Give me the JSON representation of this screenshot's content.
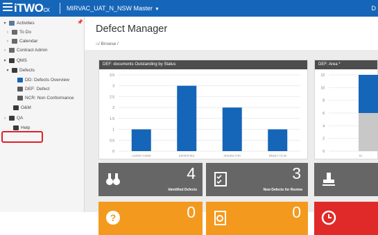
{
  "topbar": {
    "logo": "iTWO",
    "logo_suffix": "cx",
    "project_name": "MIRVAC_UAT_N_NSW Master",
    "right_text": "D",
    "color": "#1565b8"
  },
  "sidebar": {
    "items": [
      {
        "label": "Activities",
        "arrow": "▾",
        "icon": "activities-icon"
      },
      {
        "label": "To Do",
        "arrow": "›",
        "icon": "todo-icon"
      },
      {
        "label": "Calendar",
        "arrow": "›",
        "icon": "calendar-icon"
      },
      {
        "label": "Contract Admin",
        "arrow": "›",
        "icon": "contract-admin-icon"
      },
      {
        "label": "QMS",
        "arrow": "▾",
        "icon": "folder-icon"
      },
      {
        "label": "Defects",
        "arrow": "▾",
        "icon": "defects-icon"
      },
      {
        "label": "DD: Defects Overview",
        "arrow": "",
        "icon": "overview-icon"
      },
      {
        "label": "DEF: Defect",
        "arrow": "",
        "icon": "defect-icon"
      },
      {
        "label": "NCR: Non Conformance",
        "arrow": "",
        "icon": "ncr-icon"
      },
      {
        "label": "O&M",
        "arrow": "",
        "icon": "folder-icon"
      },
      {
        "label": "QA",
        "arrow": "›",
        "icon": "qa-icon"
      },
      {
        "label": "Help",
        "arrow": "",
        "icon": "help-icon"
      }
    ],
    "highlight_color": "#e0202a"
  },
  "main": {
    "title": "Defect Manager",
    "breadcrumb": "/ Browse /"
  },
  "panels": {
    "status_chart_title": "DEF: documents Outstanding by Status",
    "area_chart_title": "DEF: Area *"
  },
  "chart_data": [
    {
      "type": "bar",
      "title": "DEF: documents Outstanding by Status",
      "categories": [
        "CLIENT COMS",
        "IDENTIFIED",
        "ISSUED FOR",
        "READY TO IN"
      ],
      "values": [
        1,
        3,
        2,
        1
      ],
      "ylim": [
        0,
        3.5
      ],
      "yticks": [
        "3.5",
        "3",
        "2.5",
        "2",
        "1.5",
        "1",
        "0.5",
        "0"
      ],
      "grid": true,
      "bar_color": "#1565b8"
    },
    {
      "type": "bar",
      "stacked": true,
      "title": "DEF: Area *",
      "categories": [
        "S1"
      ],
      "series": [
        {
          "values": [
            6
          ]
        },
        {
          "values": [
            6
          ]
        }
      ],
      "series_colors": [
        "#c8c8c8",
        "#1565b8"
      ],
      "ylim": [
        0,
        12
      ],
      "yticks": [
        "12",
        "10",
        "8",
        "6",
        "4",
        "2",
        "0"
      ],
      "grid": true
    }
  ],
  "tiles": [
    {
      "value": "4",
      "label": "Identified Defects",
      "color": "#666666",
      "icon": "binoculars-icon"
    },
    {
      "value": "3",
      "label": "New Defects for Review",
      "color": "#666666",
      "icon": "checklist-icon"
    },
    {
      "value": "",
      "label": "",
      "color": "#666666",
      "icon": "stamp-icon"
    },
    {
      "value": "0",
      "label": "",
      "color": "#f39a1e",
      "icon": "question-icon"
    },
    {
      "value": "0",
      "label": "",
      "color": "#f39a1e",
      "icon": "refresh-doc-icon"
    },
    {
      "value": "",
      "label": "",
      "color": "#e02a2a",
      "icon": "clock-icon"
    }
  ]
}
